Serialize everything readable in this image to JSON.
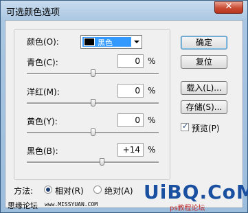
{
  "window": {
    "title": "可选颜色选项",
    "close_label": "✕"
  },
  "colors_row": {
    "label": "颜色(O):",
    "selected": "黑色",
    "swatch_color": "#000000"
  },
  "sliders": [
    {
      "label": "青色(C):",
      "value": "0",
      "unit": "%",
      "percent": 0
    },
    {
      "label": "洋红(M):",
      "value": "0",
      "unit": "%",
      "percent": 0
    },
    {
      "label": "黄色(Y):",
      "value": "0",
      "unit": "%",
      "percent": 0
    },
    {
      "label": "黑色(B):",
      "value": "+14",
      "unit": "%",
      "percent": 14
    }
  ],
  "buttons": {
    "ok": "确定",
    "reset": "复位",
    "load": "载入(L)...",
    "save": "存储(S)...",
    "preview_label": "预览(P)",
    "preview_checked": true
  },
  "method": {
    "label": "方法:",
    "options": [
      "相对(R)",
      "绝对(A)"
    ],
    "selected": 0
  },
  "watermark": {
    "left_text": "思缘论坛",
    "url": "www.MISSYUAN.COM",
    "logo": "UiBQ.CoM",
    "logo_sub": "ps教程论坛"
  }
}
